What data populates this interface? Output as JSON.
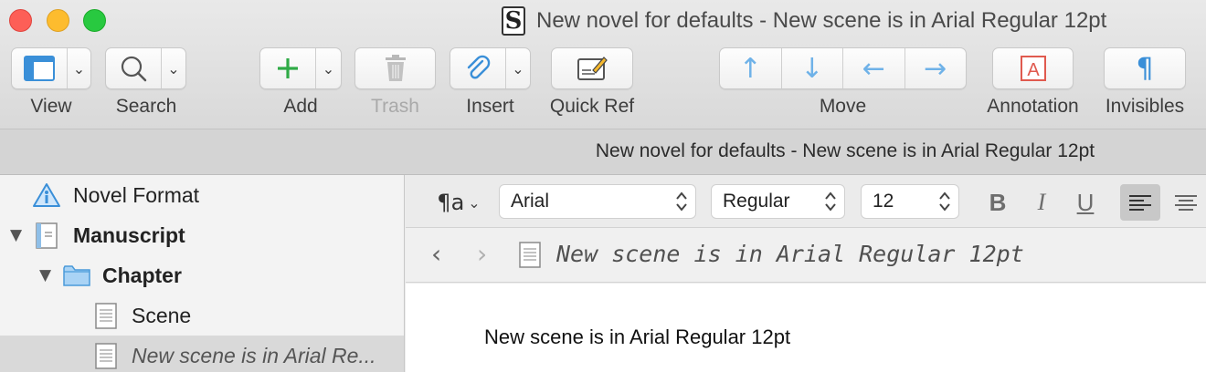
{
  "window": {
    "title": "New novel for defaults - New scene is in Arial Regular 12pt"
  },
  "toolbar": {
    "view_label": "View",
    "search_label": "Search",
    "add_label": "Add",
    "trash_label": "Trash",
    "insert_label": "Insert",
    "quickref_label": "Quick Ref",
    "move_label": "Move",
    "annotation_label": "Annotation",
    "invisibles_label": "Invisibles"
  },
  "header": {
    "title": "New novel for defaults - New scene is in Arial Regular 12pt"
  },
  "binder": {
    "items": [
      {
        "label": "Novel Format",
        "icon": "info-warning-icon"
      },
      {
        "label": "Manuscript",
        "icon": "manuscript-icon",
        "expanded": true
      },
      {
        "label": "Chapter",
        "icon": "folder-icon",
        "expanded": true
      },
      {
        "label": "Scene",
        "icon": "document-icon"
      },
      {
        "label": "New scene is in Arial Re...",
        "icon": "document-icon",
        "selected": true
      }
    ]
  },
  "format_bar": {
    "font_family": "Arial",
    "font_style": "Regular",
    "font_size": "12"
  },
  "nav": {
    "title": "New scene is in Arial Regular 12pt"
  },
  "editor": {
    "text": "New scene is in Arial Regular 12pt"
  }
}
